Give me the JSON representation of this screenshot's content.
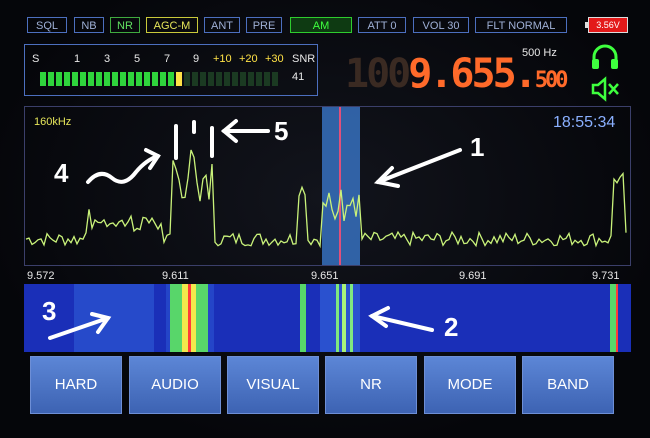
{
  "status_tags": [
    {
      "label": "SQL",
      "style": "blue"
    },
    {
      "label": "NB",
      "style": "blue"
    },
    {
      "label": "NR",
      "style": "green"
    },
    {
      "label": "AGC-M",
      "style": "yellow"
    },
    {
      "label": "ANT",
      "style": "blue"
    },
    {
      "label": "PRE",
      "style": "blue"
    },
    {
      "label": "AM",
      "style": "am"
    },
    {
      "label": "ATT 0",
      "style": "blue"
    },
    {
      "label": "VOL 30",
      "style": "blue"
    },
    {
      "label": "FLT NORMAL",
      "style": "blue"
    }
  ],
  "battery": {
    "voltage": "3.56V",
    "color": "#e31a1a"
  },
  "s_meter": {
    "scale": [
      "S",
      "1",
      "3",
      "5",
      "7",
      "9",
      "+10",
      "+20",
      "+30"
    ],
    "snr_label": "SNR",
    "snr_value": "41",
    "level_fraction": 0.61
  },
  "frequency": {
    "dim_digits": "100",
    "bright_digits": "9.655.",
    "small_digits": "500",
    "step": "500 Hz"
  },
  "icons": {
    "headphones": "headphones-icon",
    "speaker": "speaker-muted-icon"
  },
  "spectrum": {
    "bandwidth": "160kHz",
    "clock": "18:55:34"
  },
  "freq_ticks": [
    "9.572",
    "9.611",
    "9.651",
    "9.691",
    "9.731"
  ],
  "buttons": [
    "HARD",
    "AUDIO",
    "VISUAL",
    "NR",
    "MODE",
    "BAND"
  ],
  "annotations": [
    "1",
    "2",
    "3",
    "4",
    "5"
  ],
  "colors": {
    "accent_green": "#3eff3e",
    "freq_orange": "#ff6a2a",
    "clock_blue": "#8ab0ff",
    "trace": "#c9f27a"
  }
}
